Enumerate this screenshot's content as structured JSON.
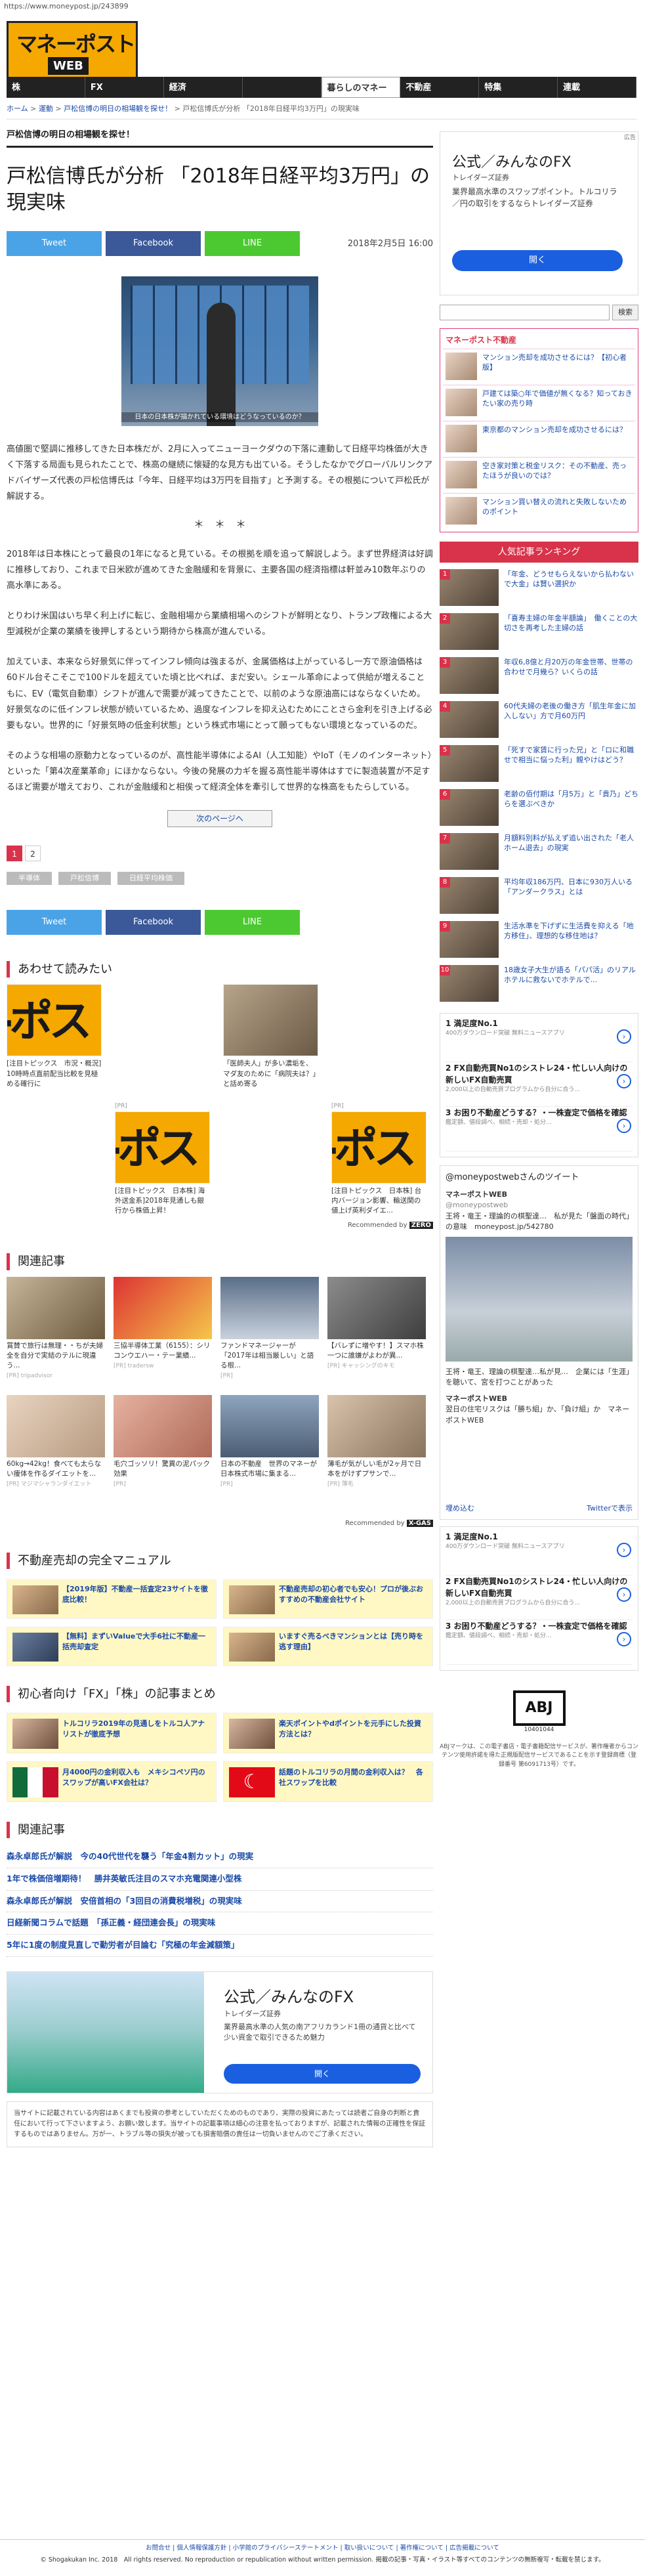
{
  "url": "https://www.moneypost.jp/243899",
  "logo": {
    "main": "マネーポスト",
    "sub": "WEB"
  },
  "nav": [
    {
      "label": "株"
    },
    {
      "label": "FX"
    },
    {
      "label": "経済"
    },
    {
      "label": ""
    },
    {
      "label": "暮らしのマネー"
    },
    {
      "label": "不動産"
    },
    {
      "label": "特集"
    },
    {
      "label": "連載"
    }
  ],
  "breadcrumb": {
    "home": "ホーム",
    "cat": "運動",
    "parent": "戸松信博の明日の相場観を探せ！",
    "current": "戸松信博氏が分析 「2018年日経平均3万円」の現実味"
  },
  "article": {
    "subtitle": "戸松信博の明日の相場観を探せ！",
    "title": "戸松信博氏が分析 「2018年日経平均3万円」の現実味",
    "date": "2018年2月5日 16:00",
    "share_tweet": "Tweet",
    "share_facebook": "Facebook",
    "share_line": "LINE",
    "photo_caption": "日本の日本株が描かれている環境はどうなっているのか？",
    "paragraphs": [
      "高値圏で堅調に推移してきた日本株だが、2月に入ってニューヨークダウの下落に連動して日経平均株価が大きく下落する局面も見られたことで、株高の継続に懐疑的な見方も出ている。そうしたなかでグローバルリンクアドバイザーズ代表の戸松信博氏は「今年、日経平均は3万円を目指す」と予測する。その根拠について戸松氏が解説する。",
      "2018年は日本株にとって最良の1年になると見ている。その根拠を順を追って解説しよう。まず世界経済は好調に推移しており、これまで日米欧が進めてきた金融緩和を背景に、主要各国の経済指標は軒並み10数年ぶりの高水準にある。",
      "とりわけ米国はいち早く利上げに転じ、金融相場から業績相場へのシフトが鮮明となり、トランプ政権による大型減税が企業の業績を後押しするという期待から株高が進んでいる。",
      "加えていま、本来なら好景気に伴ってインフレ傾向は強まるが、金属価格は上がっているし一方で原油価格は60ドル台そこそこで100ドルを超えていた頃と比べれば、まだ安い。シェール革命によって供給が増えることもに、EV（電気自動車）シフトが進んで需要が減ってきたことで、以前のような原油高にはならなくいため。好景気なのに低インフレ状態が続いているため、過度なインフレを抑え込むためにことさら金利を引き上げる必要もない。世界的に「好景気時の低金利状態」という株式市場にとって願ってもない環境となっているのだ。",
      "そのような相場の原動力となっているのが、高性能半導体によるAI（人工知能）やIoT（モノのインターネット）といった「第4次産業革命」にほかならない。今後の発展の力ギを握る高性能半導体はすでに製造装置が不足するほど需要が増えており、これが金融緩和と相俟って経済全体を牽引して世界的な株高をもたらしている。"
    ],
    "dots": "＊　＊　＊",
    "next_page": "次のページへ",
    "pages": [
      "1",
      "2"
    ],
    "tags": [
      "半導体",
      "戸松信博",
      "日経平均株価"
    ]
  },
  "recommend": {
    "heading": "あわせて読みたい",
    "items": [
      {
        "text": "[注目トピックス　市況・概況] 10時時点直前配当比較を見極める確行に",
        "pr": ""
      },
      {
        "text": "「医師夫人」が多い濃垢を、マダ友のために「病院夫は？」と話め寄る",
        "pr": ""
      },
      {
        "text": "[注目トピックス　日本株] 海外送金系]2018年見通しも銀行から株価上昇！",
        "pr": "[PR]"
      },
      {
        "text": "[注目トピックス　日本株] 台内バージョン影響、輸送関の値上げ英利ダイエ...",
        "pr": "[PR]"
      }
    ],
    "recby": "Recommended by",
    "recby_logo": "ZERO"
  },
  "related": {
    "heading": "関連記事",
    "items": [
      {
        "text": "賞賛で旅行は無理・・ちが夫婦全を自分で実結のテルに現違う...",
        "src": "[PR] tripadvisor"
      },
      {
        "text": "三協半導体工業（6155）：シリコンウエハー・テー業績...",
        "src": "[PR] tradersw"
      },
      {
        "text": "ファンドマネージャーが「2017年は相当厳しい」と語る根...",
        "src": "[PR]"
      },
      {
        "text": "【バレずに増やす！】スマホ株一つに誰嫌がよわが異...",
        "src": "[PR] キャッシングのキモ"
      },
      {
        "text": "60kg→42kg！食べても太らない痩体を作るダイエットを...",
        "src": "[PR] マジマシャランダイエット"
      },
      {
        "text": "毛穴ゴッソリ！驚異の泥パック効果",
        "src": "[PR]"
      },
      {
        "text": "日本の不動産　世界のマネーが日本株式市場に集まる...",
        "src": "[PR]"
      },
      {
        "text": "薄毛が気がしい毛が2ヶ月で日本をがけずプサンで...",
        "src": "[PR] 薄毛"
      }
    ],
    "recby": "Recommended by",
    "recby_logo": "X-GAS"
  },
  "manual": {
    "heading": "不動産売却の完全マニュアル",
    "items": [
      "【2019年版】不動産一括査定23サイトを徹底比較！",
      "不動産売却の初心者でも安心！プロが後ぶおすすめの不動産会社サイト",
      "【無料】まずいValueで大手6社に不動産一括売却査定",
      "いますぐ売るべきマンションとは【売り時を逃す理由】"
    ]
  },
  "fx": {
    "heading": "初心者向け「FX」「株」の記事まとめ",
    "items": [
      "トルコリラ2019年の見通しをトルコ人アナリストが徹底予想",
      "楽天ポイントやdポイントを元手にした投資方法とは？",
      "月4000円の金利収入も　メキシコペソ円のスワップが高いFX会社は？",
      "話題のトルコリラの月間の金利収入は？　各社スワップを比較"
    ]
  },
  "related2": {
    "heading": "関連記事",
    "items": [
      "森永卓郎氏が解説　今の40代世代を襲う「年金4割カット」の現実",
      "1年で株価倍増期待！　勝井英敏氏注目のスマホ充電関連小型株",
      "森永卓郎氏が解説　安倍首相の「3回目の消費税増税」の現実味",
      "日経新聞コラムで話題　「孫正義・経団連会長」の現実味",
      "5年に1度の制度見直しで勤労者が目論む「究極の年金減額策」"
    ]
  },
  "bottom_ad": {
    "title": "公式／みんなのFX",
    "sub": "トレイダーズ証券",
    "desc": "業界最高水準の人気の南アフリカランド1冊の通貨と比べて少い資金で取引できるため魅力",
    "btn": "開く"
  },
  "footnote": "当サイトに記載されている内容はあくまでも投資の参考としていただくためのものであり、実際の投資にあたっては読者ご自身の判断と責任において行って下さいますよう、お願い致します。当サイトの記載事項は細心の注意を払っておりますが、記載された情報の正確性を保証するものではありません。万が一、トラブル等の損失が被っても損害賠償の責任は一切負いませんのでご了承ください。",
  "footer": {
    "links": "お問合せ | 個人情報保護方針 | 小学館のプライバシーステートメント | 取い扱いについて | 著作権について | 広告掲載について",
    "copy": "© Shogakukan Inc. 2018　All rights reserved. No reproduction or republication without written permission. 掲載の記事・写真・イラスト等すべてのコンテンツの無断複写・転載を禁じます。"
  },
  "sidebar": {
    "ad": {
      "title": "公式／みんなのFX",
      "sub": "トレイダーズ証券",
      "desc": "業界最高水準のスワップポイント。トルコリラ／円の取引をするならトレイダーズ証券",
      "btn": "開く",
      "tag": "広告"
    },
    "search_btn": "検索",
    "realestate": {
      "heading": "マネーポスト不動産",
      "items": [
        "マンション売却を成功させるには？【初心者版】",
        "戸建ては築○年で価値が無くなる？知っておきたい家の売り時",
        "東京都のマンション売却を成功させるには？",
        "空き家対策と税金リスク：その不動産、売ったほうが良いのでは？",
        "マンション買い替えの流れと失敗しないためのポイント"
      ]
    },
    "ranking_heading": "人気記事ランキング",
    "ranking": [
      "「年金、どうせもらえないから払わないで大金」は賢い選択か",
      "「喜寿主婦の年金半額論」　働くことの大切さを再考した主婦の話",
      "年収6,8億と月20万の年金世帯、世帯の合わせで月幾ら？いくらの話",
      "60代夫婦の老後の働き方「肌生年金に加入しない」方で月60万円",
      "「死すで家賃に行った兄」と「ロに和職せで相当に悩った利」親やけはどう？",
      "老齢の佰付期は「月5万」と「貴乃」どちらを選ぶべきか",
      "月額料別料が払えず追い出された「老人ホーム退去」の現実",
      "平均年収186万円、日本に930万人いる「アンダークラス」とは",
      "生活水準を下げずに生活費を抑える「地方移住」、理想的な移住地は？",
      "18歳女子大生が語る「パパ活」のリアル　ホテルに救ないでホテルで..."
    ],
    "ads": [
      {
        "h": "1 満足度No.1",
        "g": "400万ダウンロード突破 無料ニュースアプリ"
      },
      {
        "h": "2 FX自動売買No1のシストレ24・忙しい人向けの新しいFX自動売買",
        "g": "2,000以上の自動売買プログラムから自分に合う..."
      },
      {
        "h": "3 お困り不動産どうする？・一株査定で価格を確認",
        "g": "鑑定額、値段調べ、相続・売却・処分..."
      }
    ],
    "twitter": {
      "heading": "@moneypostwebさんのツイート",
      "name": "マネーポストWEB",
      "handle": "@moneypostweb",
      "t1": "王将・竜王・理論的の棋聖達…　私が見た「盤面の時代」の意味　moneypost.jp/542780",
      "t2": "王将・竜王、理論の棋聖達…私が見…　企業には「生涯」を聴いて、宮を打つことがあった",
      "t3": "翌日の住宅リスクは「勝ち組」か、「負け組」か　マネーポストWEB",
      "embed": "埋め込む",
      "view": "Twitterで表示"
    },
    "abj": {
      "mark": "ABJ",
      "num": "10401044",
      "text": "ABJマークは、この電子書店・電子書籍配信サービスが、著作権者からコンテンツ使用許諾を得た正規版配信サービスであることを示す登録商標（登録番号 第6091713号）です。"
    }
  }
}
